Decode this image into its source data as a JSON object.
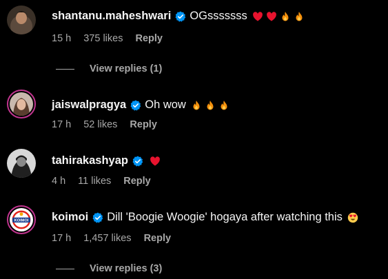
{
  "comments": [
    {
      "username": "shantanu.maheshwari",
      "text": "OGsssssss",
      "emojis": [
        "heart-icon",
        "heart-icon",
        "fire-icon",
        "fire-icon"
      ],
      "time": "15 h",
      "likes": "375 likes",
      "reply": "Reply",
      "view_replies": "View replies (1)"
    },
    {
      "username": "jaiswalpragya",
      "text": "Oh wow",
      "emojis": [
        "fire-icon",
        "fire-icon",
        "fire-icon"
      ],
      "time": "17 h",
      "likes": "52 likes",
      "reply": "Reply"
    },
    {
      "username": "tahirakashyap",
      "text": "",
      "emojis": [
        "heart-icon"
      ],
      "time": "4 h",
      "likes": "11 likes",
      "reply": "Reply"
    },
    {
      "username": "koimoi",
      "text": "Dill 'Boogie Woogie' hogaya after watching this",
      "emojis": [
        "heart-eyes-icon"
      ],
      "time": "17 h",
      "likes": "1,457 likes",
      "reply": "Reply",
      "view_replies": "View replies (3)",
      "avatar_logo_text": "KOIMOI"
    }
  ],
  "colors": {
    "background": "#000000",
    "primary_text": "#f5f5f5",
    "secondary_text": "#a8a8a8",
    "verified": "#0095f6",
    "story_ring": "#c1358f"
  }
}
